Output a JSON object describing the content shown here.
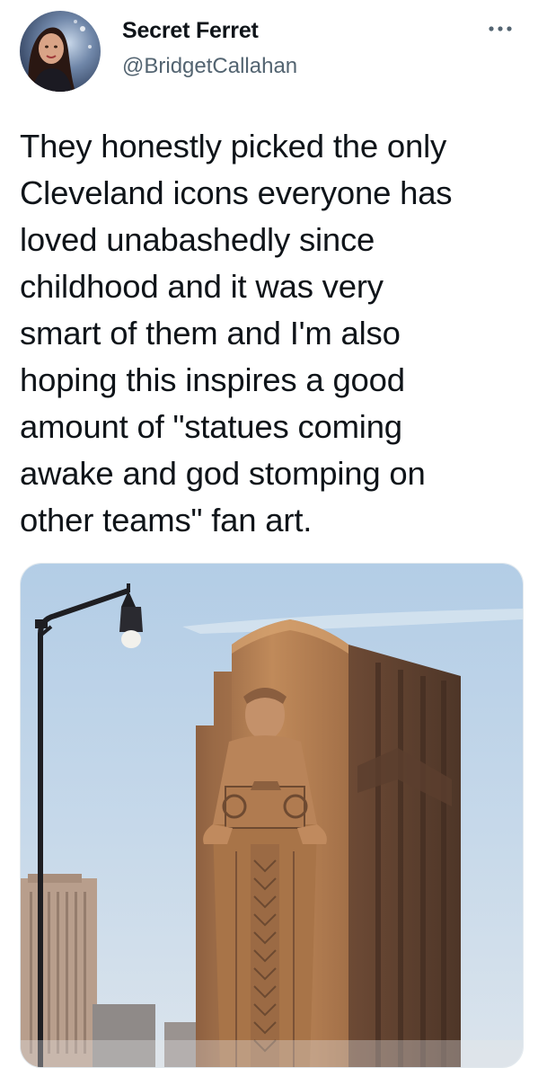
{
  "tweet": {
    "author": {
      "display_name": "Secret Ferret",
      "handle": "@BridgetCallahan",
      "avatar_icon": "profile-photo"
    },
    "more_icon": "more-horizontal-icon",
    "text": "They honestly picked the only\nCleveland icons everyone has\nloved unabashedly since\nchildhood and it was very\nsmart of them and I'm also\nhoping this inspires a good\namount of \"statues coming\nawake and god stomping on\nother teams\" fan art.",
    "media": {
      "kind": "photo",
      "subject": "guardian-statue-photo"
    }
  },
  "colors": {
    "text": "#0f1419",
    "secondary_text": "#536471",
    "sky": "#b9d2e8",
    "stone": "#b07a4d"
  }
}
